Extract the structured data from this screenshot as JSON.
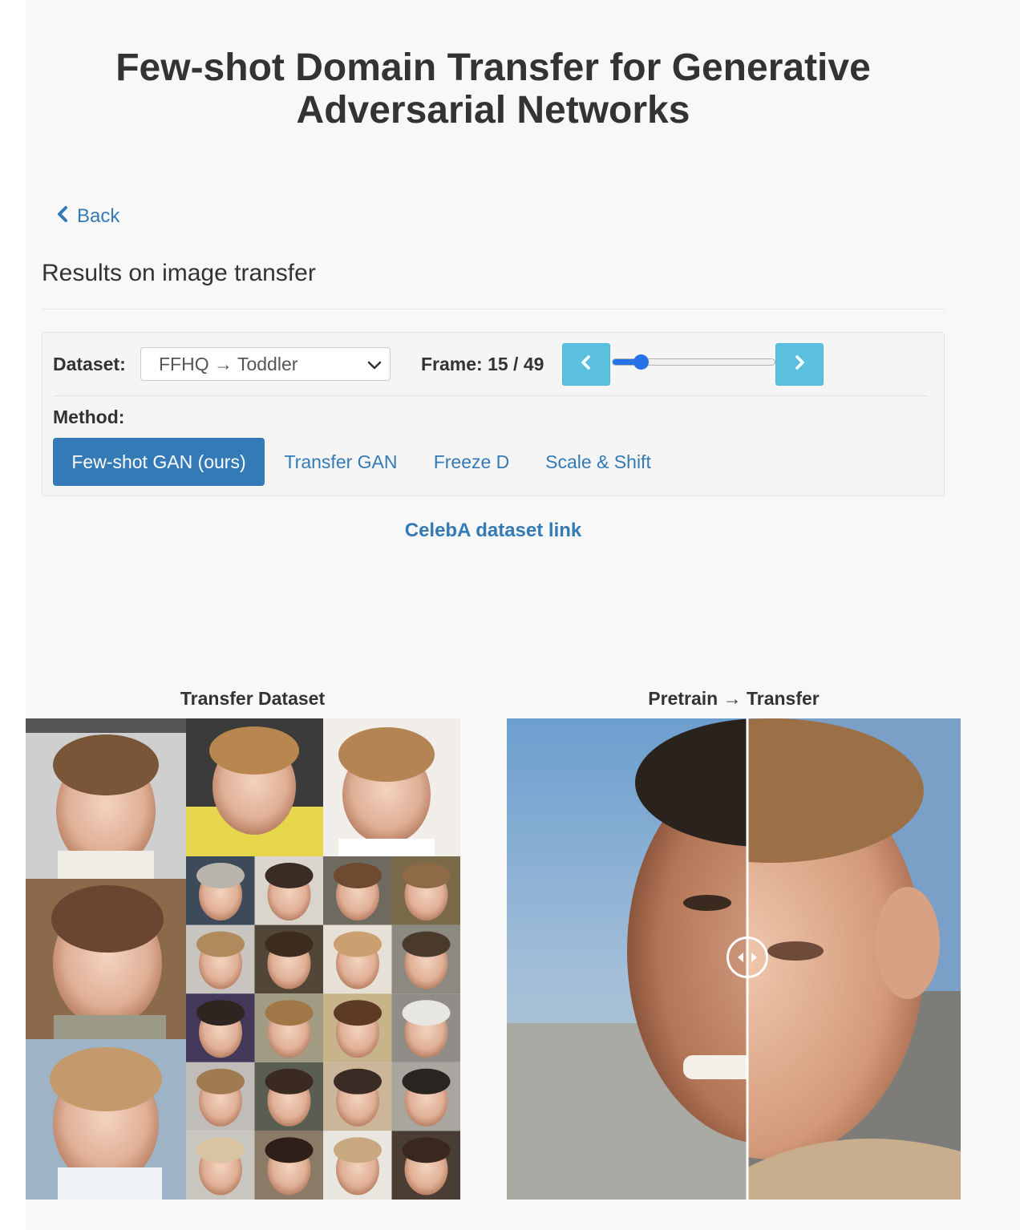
{
  "page": {
    "title": "Few-shot Domain Transfer for Generative Adversarial Networks"
  },
  "nav": {
    "back_label": "Back"
  },
  "section": {
    "title": "Results on image transfer"
  },
  "controls": {
    "dataset_label": "Dataset:",
    "dataset_selected": "FFHQ → Toddler",
    "frame_label": "Frame: 15 / 49",
    "frame_current": 15,
    "frame_total": 49,
    "frame_progress_fraction": 0.14,
    "method_label": "Method:",
    "methods": [
      {
        "label": "Few-shot GAN (ours)",
        "active": true
      },
      {
        "label": "Transfer GAN",
        "active": false
      },
      {
        "label": "Freeze D",
        "active": false
      },
      {
        "label": "Scale & Shift",
        "active": false
      }
    ]
  },
  "links": {
    "celeba": "CelebA dataset link"
  },
  "figures": {
    "transfer_dataset_caption": "Transfer Dataset",
    "pretrain_transfer_caption": "Pretrain → Transfer",
    "compare_divider_fraction": 0.53
  },
  "colors": {
    "link": "#337ab7",
    "active_button": "#337ab7",
    "step_button": "#5bc0de",
    "slider": "#2673e8"
  },
  "icons": {
    "back": "chevron-left-icon",
    "select": "chevron-down-icon",
    "prev_frame": "chevron-left-icon",
    "next_frame": "chevron-right-icon",
    "compare_handle": "drag-handle-icon"
  }
}
